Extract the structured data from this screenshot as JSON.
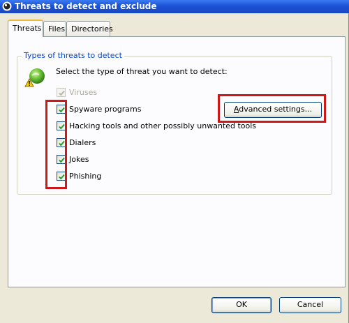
{
  "window": {
    "title": "Threats to detect and exclude"
  },
  "tabs": [
    {
      "label": "Threats"
    },
    {
      "label": "Files"
    },
    {
      "label": "Directories"
    }
  ],
  "group": {
    "label": "Types of threats to detect",
    "prompt": "Select the type of threat you want to detect:",
    "options": [
      {
        "label": "Viruses",
        "checked": true,
        "disabled": true
      },
      {
        "label": "Spyware programs",
        "checked": true,
        "disabled": false
      },
      {
        "label": "Hacking tools and other possibly unwanted tools",
        "checked": true,
        "disabled": false
      },
      {
        "label": "Dialers",
        "checked": true,
        "disabled": false
      },
      {
        "label": "Jokes",
        "checked": true,
        "disabled": false
      },
      {
        "label": "Phishing",
        "checked": true,
        "disabled": false
      }
    ],
    "advanced_button": {
      "accel": "A",
      "rest": "dvanced settings..."
    }
  },
  "buttons": {
    "ok": "OK",
    "cancel": "Cancel"
  },
  "colors": {
    "highlight": "#cc1a1a",
    "titlebar": "#1c52d6",
    "check": "#21a121"
  }
}
